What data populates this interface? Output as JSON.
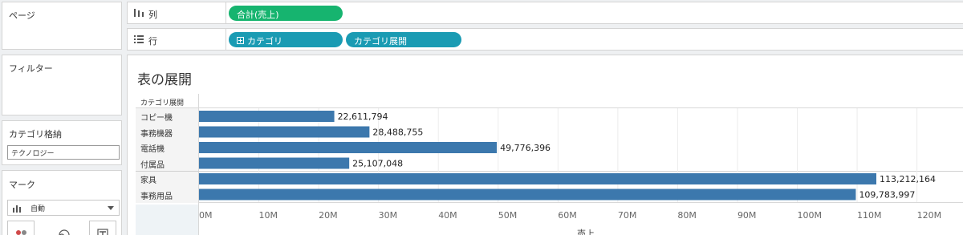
{
  "panels": {
    "page": {
      "title": "ページ"
    },
    "filter": {
      "title": "フィルター"
    },
    "category_store": {
      "title": "カテゴリ格納",
      "value": "テクノロジー"
    },
    "marks": {
      "title": "マーク",
      "mark_type": "自動"
    }
  },
  "shelves": {
    "columns": {
      "label": "列",
      "pills": [
        "合計(売上)"
      ]
    },
    "rows": {
      "label": "行",
      "pills": [
        "カテゴリ",
        "カテゴリ展開"
      ]
    }
  },
  "colors": {
    "bar": "#3c78ad",
    "measure_pill": "#16b46f",
    "dimension_pill": "#1a9bb3"
  },
  "view": {
    "title": "表の展開",
    "row_header": "カテゴリ展開"
  },
  "chart_data": {
    "type": "bar",
    "orientation": "horizontal",
    "categories": [
      "コピー機",
      "事務機器",
      "電話機",
      "付属品",
      "家具",
      "事務用品"
    ],
    "values": [
      22611794,
      28488755,
      49776396,
      25107048,
      113212164,
      109783997
    ],
    "value_labels": [
      "22,611,794",
      "28,488,755",
      "49,776,396",
      "25,107,048",
      "113,212,164",
      "109,783,997"
    ],
    "xticks": [
      0,
      10000000,
      20000000,
      30000000,
      40000000,
      50000000,
      60000000,
      70000000,
      80000000,
      90000000,
      100000000,
      110000000,
      120000000
    ],
    "xtick_labels": [
      "0M",
      "10M",
      "20M",
      "30M",
      "40M",
      "50M",
      "60M",
      "70M",
      "80M",
      "90M",
      "100M",
      "110M",
      "120M"
    ],
    "xlabel": "売上",
    "xlim": [
      0,
      128000000
    ],
    "grid": true
  }
}
